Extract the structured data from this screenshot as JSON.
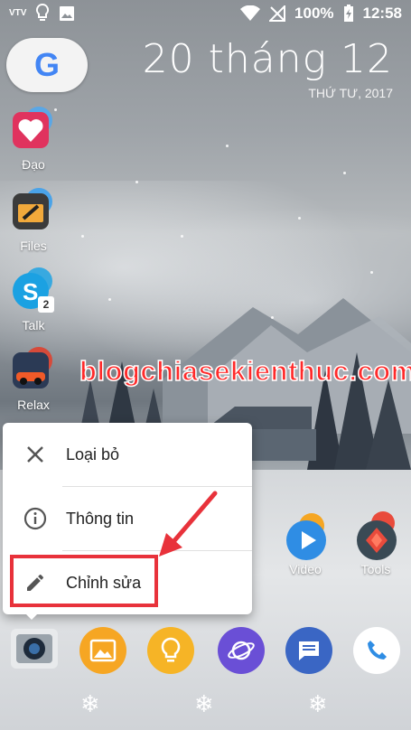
{
  "status_bar": {
    "carrier_badge": "VTV",
    "battery": "100%",
    "time": "12:58",
    "icons": [
      "vtv-icon",
      "bulb-icon",
      "image-icon",
      "wifi-icon",
      "no-signal-icon",
      "battery-charging-icon"
    ]
  },
  "search_widget": {
    "logo": "G"
  },
  "date_widget": {
    "date": "20 tháng 12",
    "weekday": "THỨ TƯ, 2017"
  },
  "left_apps": [
    {
      "label": "Đạo"
    },
    {
      "label": "Files"
    },
    {
      "label": "Talk",
      "badge": "2"
    },
    {
      "label": "Relax"
    }
  ],
  "watermark": "blogchiasekienthuc.com",
  "popup_menu": {
    "items": [
      {
        "label": "Loại bỏ",
        "icon": "close-icon"
      },
      {
        "label": "Thông tin",
        "icon": "info-icon"
      },
      {
        "label": "Chỉnh sửa",
        "icon": "pencil-icon"
      }
    ]
  },
  "right_apps": [
    {
      "label": "Video"
    },
    {
      "label": "Tools"
    }
  ],
  "dock": [
    "camera-icon",
    "gallery-icon",
    "tips-bulb-icon",
    "internet-browser-icon",
    "messages-icon",
    "phone-icon"
  ],
  "colors": {
    "highlight": "#e8323b",
    "watermark": "#ff2a2a"
  }
}
